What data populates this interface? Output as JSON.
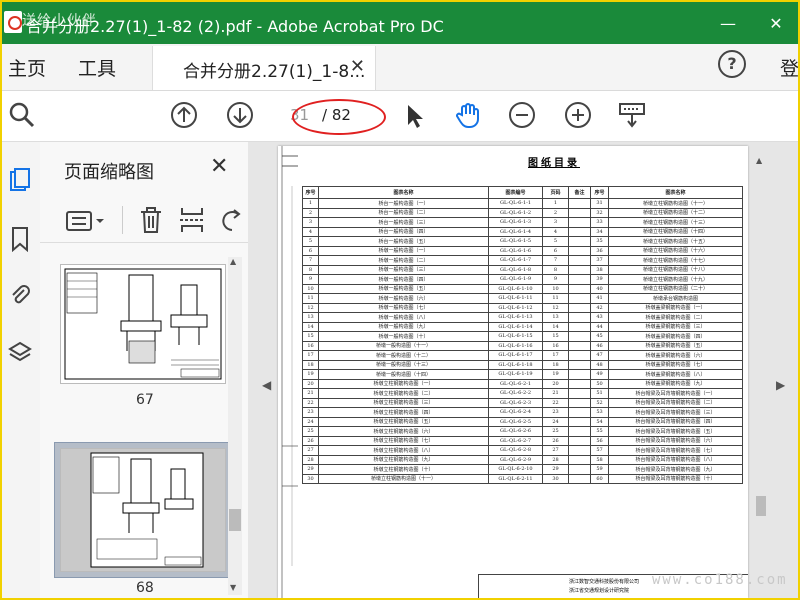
{
  "window": {
    "watermark": "送给小伙伴",
    "title": "合并分册2.27(1)_1-82 (2).pdf - Adobe Acrobat Pro DC",
    "minimize": "—",
    "close": "✕"
  },
  "menu": {
    "home": "主页",
    "tools": "工具",
    "doc_tab": "合并分册2.27(1)_1-8...",
    "doc_tab_close": "✕",
    "help": "?",
    "login": "登"
  },
  "toolbar": {
    "current_page": "31",
    "total_pages": "/ 82"
  },
  "thumbnails": {
    "title": "页面缩略图",
    "close": "✕",
    "pages": [
      "67",
      "68"
    ]
  },
  "document": {
    "page_title": "图纸目录",
    "headers": [
      "序号",
      "图表名称",
      "图表编号",
      "页码",
      "备注",
      "序号",
      "图表名称"
    ],
    "rows": [
      [
        "1",
        "桥台一般构造图（一）",
        "GL-QL-6-1-1",
        "1",
        "",
        "31",
        "桥墩立柱钢筋构造图（十一）"
      ],
      [
        "2",
        "桥台一般构造图（二）",
        "GL-QL-6-1-2",
        "2",
        "",
        "32",
        "桥墩立柱钢筋构造图（十二）"
      ],
      [
        "3",
        "桥台一般构造图（三）",
        "GL-QL-6-1-3",
        "3",
        "",
        "33",
        "桥墩立柱钢筋构造图（十三）"
      ],
      [
        "4",
        "桥台一般构造图（四）",
        "GL-QL-6-1-4",
        "4",
        "",
        "34",
        "桥墩立柱钢筋构造图（十四）"
      ],
      [
        "5",
        "桥台一般构造图（五）",
        "GL-QL-6-1-5",
        "5",
        "",
        "35",
        "桥墩立柱钢筋构造图（十五）"
      ],
      [
        "6",
        "桥墩一般构造图（一）",
        "GL-QL-6-1-6",
        "6",
        "",
        "36",
        "桥墩立柱钢筋构造图（十六）"
      ],
      [
        "7",
        "桥墩一般构造图（二）",
        "GL-QL-6-1-7",
        "7",
        "",
        "37",
        "桥墩立柱钢筋构造图（十七）"
      ],
      [
        "8",
        "桥墩一般构造图（三）",
        "GL-QL-6-1-8",
        "8",
        "",
        "38",
        "桥墩立柱钢筋构造图（十八）"
      ],
      [
        "9",
        "桥墩一般构造图（四）",
        "GL-QL-6-1-9",
        "9",
        "",
        "39",
        "桥墩立柱钢筋构造图（十九）"
      ],
      [
        "10",
        "桥墩一般构造图（五）",
        "GL-QL-6-1-10",
        "10",
        "",
        "40",
        "桥墩立柱钢筋构造图（二十）"
      ],
      [
        "11",
        "桥墩一般构造图（六）",
        "GL-QL-6-1-11",
        "11",
        "",
        "41",
        "桥墩承台钢筋构造图"
      ],
      [
        "12",
        "桥墩一般构造图（七）",
        "GL-QL-6-1-12",
        "12",
        "",
        "42",
        "桥墩盖梁钢筋构造图（一）"
      ],
      [
        "13",
        "桥墩一般构造图（八）",
        "GL-QL-6-1-13",
        "13",
        "",
        "43",
        "桥墩盖梁钢筋构造图（二）"
      ],
      [
        "14",
        "桥墩一般构造图（九）",
        "GL-QL-6-1-14",
        "14",
        "",
        "44",
        "桥墩盖梁钢筋构造图（三）"
      ],
      [
        "15",
        "桥墩一般构造图（十）",
        "GL-QL-6-1-15",
        "15",
        "",
        "45",
        "桥墩盖梁钢筋构造图（四）"
      ],
      [
        "16",
        "桥墩一般构造图（十一）",
        "GL-QL-6-1-16",
        "16",
        "",
        "46",
        "桥墩盖梁钢筋构造图（五）"
      ],
      [
        "17",
        "桥墩一般构造图（十二）",
        "GL-QL-6-1-17",
        "17",
        "",
        "47",
        "桥墩盖梁钢筋构造图（六）"
      ],
      [
        "18",
        "桥墩一般构造图（十三）",
        "GL-QL-6-1-18",
        "18",
        "",
        "48",
        "桥墩盖梁钢筋构造图（七）"
      ],
      [
        "19",
        "桥墩一般构造图（十四）",
        "GL-QL-6-1-19",
        "19",
        "",
        "49",
        "桥墩盖梁钢筋构造图（八）"
      ],
      [
        "20",
        "桥墩立柱钢筋构造图（一）",
        "GL-QL-6-2-1",
        "20",
        "",
        "50",
        "桥墩盖梁钢筋构造图（九）"
      ],
      [
        "21",
        "桥墩立柱钢筋构造图（二）",
        "GL-QL-6-2-2",
        "21",
        "",
        "51",
        "桥台帽梁及耳背墙钢筋构造图（一）"
      ],
      [
        "22",
        "桥墩立柱钢筋构造图（三）",
        "GL-QL-6-2-3",
        "22",
        "",
        "52",
        "桥台帽梁及耳背墙钢筋构造图（二）"
      ],
      [
        "23",
        "桥墩立柱钢筋构造图（四）",
        "GL-QL-6-2-4",
        "23",
        "",
        "53",
        "桥台帽梁及耳背墙钢筋构造图（三）"
      ],
      [
        "24",
        "桥墩立柱钢筋构造图（五）",
        "GL-QL-6-2-5",
        "24",
        "",
        "54",
        "桥台帽梁及耳背墙钢筋构造图（四）"
      ],
      [
        "25",
        "桥墩立柱钢筋构造图（六）",
        "GL-QL-6-2-6",
        "25",
        "",
        "55",
        "桥台帽梁及耳背墙钢筋构造图（五）"
      ],
      [
        "26",
        "桥墩立柱钢筋构造图（七）",
        "GL-QL-6-2-7",
        "26",
        "",
        "56",
        "桥台帽梁及耳背墙钢筋构造图（六）"
      ],
      [
        "27",
        "桥墩立柱钢筋构造图（八）",
        "GL-QL-6-2-8",
        "27",
        "",
        "57",
        "桥台帽梁及耳背墙钢筋构造图（七）"
      ],
      [
        "28",
        "桥墩立柱钢筋构造图（九）",
        "GL-QL-6-2-9",
        "28",
        "",
        "58",
        "桥台帽梁及耳背墙钢筋构造图（八）"
      ],
      [
        "29",
        "桥墩立柱钢筋构造图（十）",
        "GL-QL-6-2-10",
        "29",
        "",
        "59",
        "桥台帽梁及耳背墙钢筋构造图（九）"
      ],
      [
        "30",
        "桥墩立柱钢筋构造图（十一）",
        "GL-QL-6-2-11",
        "30",
        "",
        "60",
        "桥台帽梁及耳背墙钢筋构造图（十）"
      ]
    ],
    "titleblock": {
      "org": "浙江数智交通科技股份有限公司",
      "dept": "浙江省交通规划设计研究院"
    },
    "corner_watermark": "www.co188.com"
  }
}
